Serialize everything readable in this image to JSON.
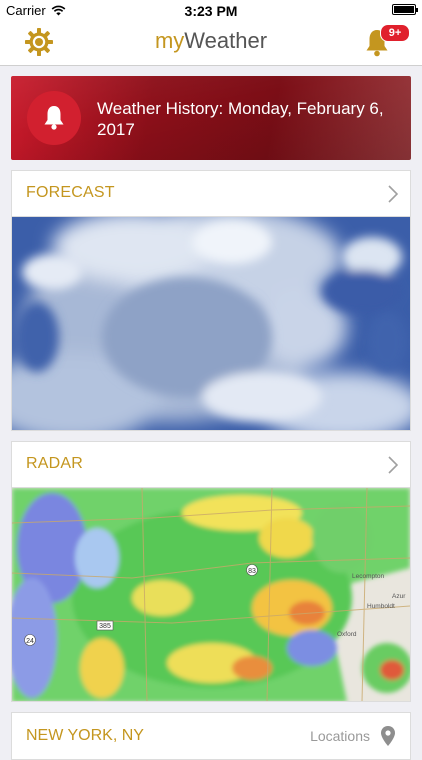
{
  "status_bar": {
    "carrier": "Carrier",
    "time": "3:23 PM"
  },
  "nav": {
    "title_my": "my",
    "title_weather": "Weather",
    "notification_badge": "9+"
  },
  "history": {
    "text": "Weather History: Monday, February 6, 2017"
  },
  "forecast": {
    "title": "FORECAST"
  },
  "radar": {
    "title": "RADAR",
    "map_labels": [
      "385",
      "24",
      "83",
      "Oxford",
      "Humboldt",
      "Lecompton",
      "Azur"
    ]
  },
  "location": {
    "city": "NEW YORK, NY",
    "locations_label": "Locations"
  },
  "colors": {
    "accent": "#c4961f",
    "banner_red": "#8c0f19",
    "badge_red": "#e0202c"
  }
}
